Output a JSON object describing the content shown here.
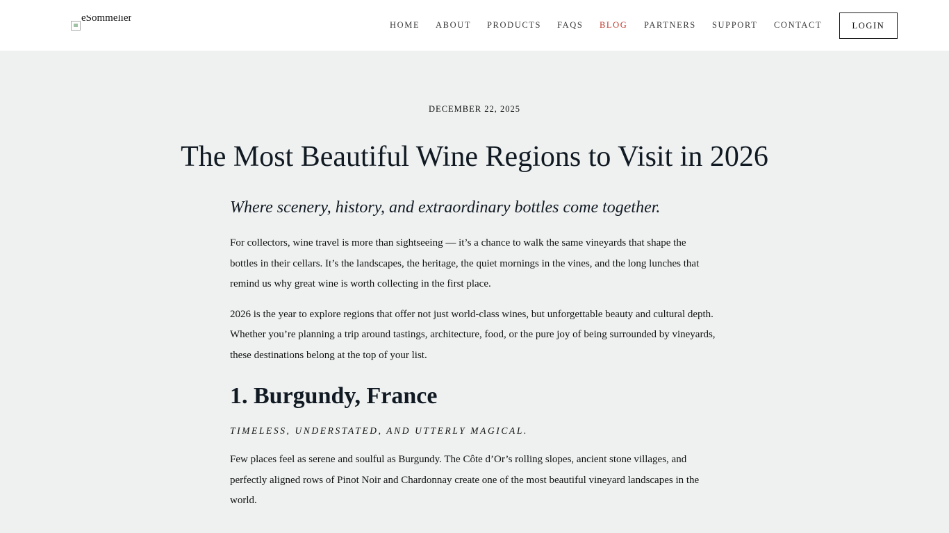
{
  "header": {
    "logo_alt": "eSommelier",
    "nav": [
      {
        "label": "HOME",
        "active": false
      },
      {
        "label": "ABOUT",
        "active": false
      },
      {
        "label": "PRODUCTS",
        "active": false
      },
      {
        "label": "FAQS",
        "active": false
      },
      {
        "label": "BLOG",
        "active": true
      },
      {
        "label": "PARTNERS",
        "active": false
      },
      {
        "label": "SUPPORT",
        "active": false
      },
      {
        "label": "CONTACT",
        "active": false
      }
    ],
    "login_label": "LOGIN",
    "active_color": "#c0392b"
  },
  "post": {
    "date": "DECEMBER 22, 2025",
    "title": "The Most Beautiful Wine Regions to Visit in 2026",
    "subtitle": "Where scenery, history, and extraordinary bottles come together.",
    "intro_paragraphs": [
      "For collectors, wine travel is more than sightseeing — it’s a chance to walk the same vineyards that shape the bottles in their cellars. It’s the landscapes, the heritage, the quiet mornings in the vines, and the long lunches that remind us why great wine is worth collecting in the first place.",
      "2026 is the year to explore regions that offer not just world-class wines, but unforgettable beauty and cultural depth. Whether you’re planning a trip around tastings, architecture, food, or the pure joy of being surrounded by vineyards, these destinations belong at the top of your list."
    ],
    "sections": [
      {
        "heading": "1. Burgundy, France",
        "tagline": "Timeless, understated, and utterly magical.",
        "paragraph": "Few places feel as serene and soulful as Burgundy. The Côte d’Or’s rolling slopes, ancient stone villages, and perfectly aligned rows of Pinot Noir and Chardonnay create one of the most beautiful vineyard landscapes in the world."
      }
    ]
  }
}
